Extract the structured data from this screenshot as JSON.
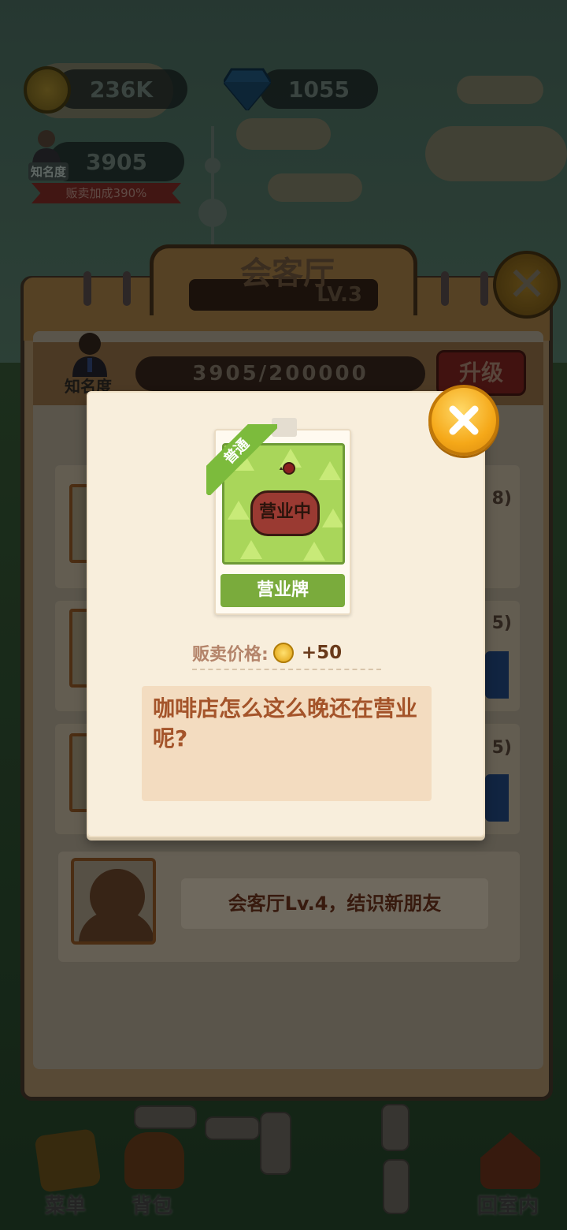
{
  "hud": {
    "coins": "236K",
    "gems": "1055",
    "fame_value": "3905",
    "fame_tag": "知名度",
    "sales_bonus": "贩卖加成390%"
  },
  "room_panel": {
    "title": "会客厅",
    "level": "LV.3",
    "fame_label": "知名度",
    "fame_progress": "3905/200000",
    "upgrade_label": "升级",
    "side_counts": [
      "8)",
      "5)",
      "5)"
    ],
    "next_unlock_message": "会客厅Lv.4，结识新朋友"
  },
  "item_modal": {
    "rarity": "普通",
    "item_name": "营业牌",
    "sign_text": "营业中",
    "price_label": "贩卖价格:",
    "price_value": "+50",
    "description": "咖啡店怎么这么晚还在营业呢?"
  },
  "bottom_nav": {
    "menu": "菜单",
    "bag": "背包",
    "back_indoor": "回室内"
  },
  "colors": {
    "modal_bg": "#f8eedc",
    "rarity_green": "#7cbb3c",
    "close_gold": "#f5a818",
    "desc_text": "#a4542a"
  }
}
